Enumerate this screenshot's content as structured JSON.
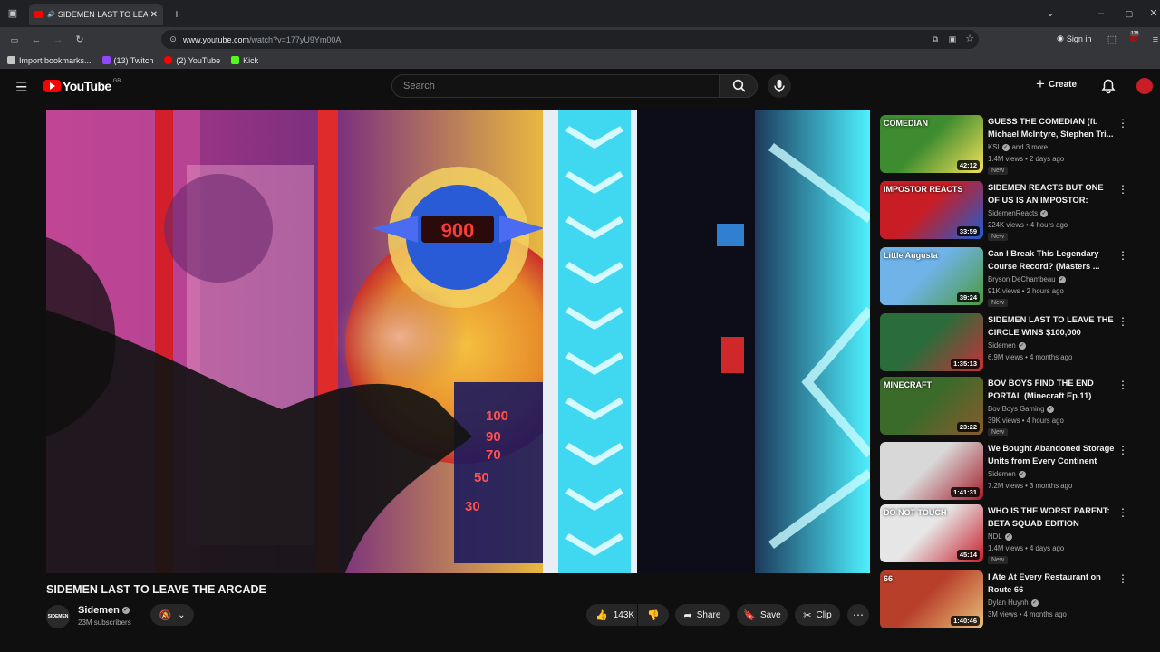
{
  "browser": {
    "tab_title": "SIDEMEN LAST TO LEAVE THE ARCADE",
    "url_domain": "www.youtube.com",
    "url_path": "/watch?v=177yU9Ym00A",
    "signin_label": "Sign in",
    "ext_badge": "178",
    "bookmarks": [
      {
        "label": "Import bookmarks...",
        "color": "#c4c7c5"
      },
      {
        "label": "(13) Twitch",
        "color": "#9146ff"
      },
      {
        "label": "(2) YouTube",
        "color": "#ff0000"
      },
      {
        "label": "Kick",
        "color": "#53fc18"
      }
    ]
  },
  "masthead": {
    "logo_text": "YouTube",
    "country_code": "GB",
    "search_placeholder": "Search",
    "create_label": "Create"
  },
  "video": {
    "title": "SIDEMEN LAST TO LEAVE THE ARCADE",
    "screen_number": "900",
    "ticket_values": [
      "100",
      "90",
      "70",
      "50",
      "30"
    ],
    "channel": {
      "avatar_text": "SIDEMEN",
      "name": "Sidemen",
      "subscribers": "23M subscribers"
    },
    "actions": {
      "likes": "143K",
      "share": "Share",
      "save": "Save",
      "clip": "Clip"
    }
  },
  "recommendations": [
    {
      "title": "GUESS THE COMEDIAN (ft. Michael McIntyre, Stephen Tri...",
      "channel": "KSI",
      "channel_extra": "and 3 more",
      "meta": "1.4M views • 2 days ago",
      "badge": "New",
      "duration": "42:12",
      "thumb": [
        "#3d8c2f",
        "#f5e05a"
      ],
      "thumb_text": "COMEDIAN"
    },
    {
      "title": "SIDEMEN REACTS BUT ONE OF US IS AN IMPOSTOR: TIKTOK ...",
      "channel": "SidemenReacts",
      "channel_extra": "",
      "meta": "224K views • 4 hours ago",
      "badge": "New",
      "duration": "33:59",
      "thumb": [
        "#c81d25",
        "#1c5fd1"
      ],
      "thumb_text": "IMPOSTOR REACTS"
    },
    {
      "title": "Can I Break This Legendary Course Record? (Masters ...",
      "channel": "Bryson DeChambeau",
      "channel_extra": "",
      "meta": "91K views • 2 hours ago",
      "badge": "New",
      "duration": "39:24",
      "thumb": [
        "#6fb3e8",
        "#4c9a3c"
      ],
      "thumb_text": "Little Augusta"
    },
    {
      "title": "SIDEMEN LAST TO LEAVE THE CIRCLE WINS $100,000",
      "channel": "Sidemen",
      "channel_extra": "",
      "meta": "6.9M views • 4 months ago",
      "badge": "",
      "duration": "1:35:13",
      "thumb": [
        "#2a6d3a",
        "#c9303a"
      ],
      "thumb_text": ""
    },
    {
      "title": "BOV BOYS FIND THE END PORTAL (Minecraft Ep.11)",
      "channel": "Bov Boys Gaming",
      "channel_extra": "",
      "meta": "39K views • 4 hours ago",
      "badge": "New",
      "duration": "23:22",
      "thumb": [
        "#3a6b2a",
        "#8a5a2c"
      ],
      "thumb_text": "MINECRAFT"
    },
    {
      "title": "We Bought Abandoned Storage Units from Every Continent an...",
      "channel": "Sidemen",
      "channel_extra": "",
      "meta": "7.2M views • 3 months ago",
      "badge": "",
      "duration": "1:41:31",
      "thumb": [
        "#d8d8d8",
        "#a31f2a"
      ],
      "thumb_text": ""
    },
    {
      "title": "WHO IS THE WORST PARENT: BETA SQUAD EDITION",
      "channel": "NDL",
      "channel_extra": "",
      "meta": "1.4M views • 4 days ago",
      "badge": "New",
      "duration": "45:14",
      "thumb": [
        "#e6e6e6",
        "#c71f2c"
      ],
      "thumb_text": "DO NOT TOUCH"
    },
    {
      "title": "I Ate At Every Restaurant on Route 66",
      "channel": "Dylan Huynh",
      "channel_extra": "",
      "meta": "3M views • 4 months ago",
      "badge": "",
      "duration": "1:40:46",
      "thumb": [
        "#b8402a",
        "#e7c07a"
      ],
      "thumb_text": "66"
    }
  ]
}
